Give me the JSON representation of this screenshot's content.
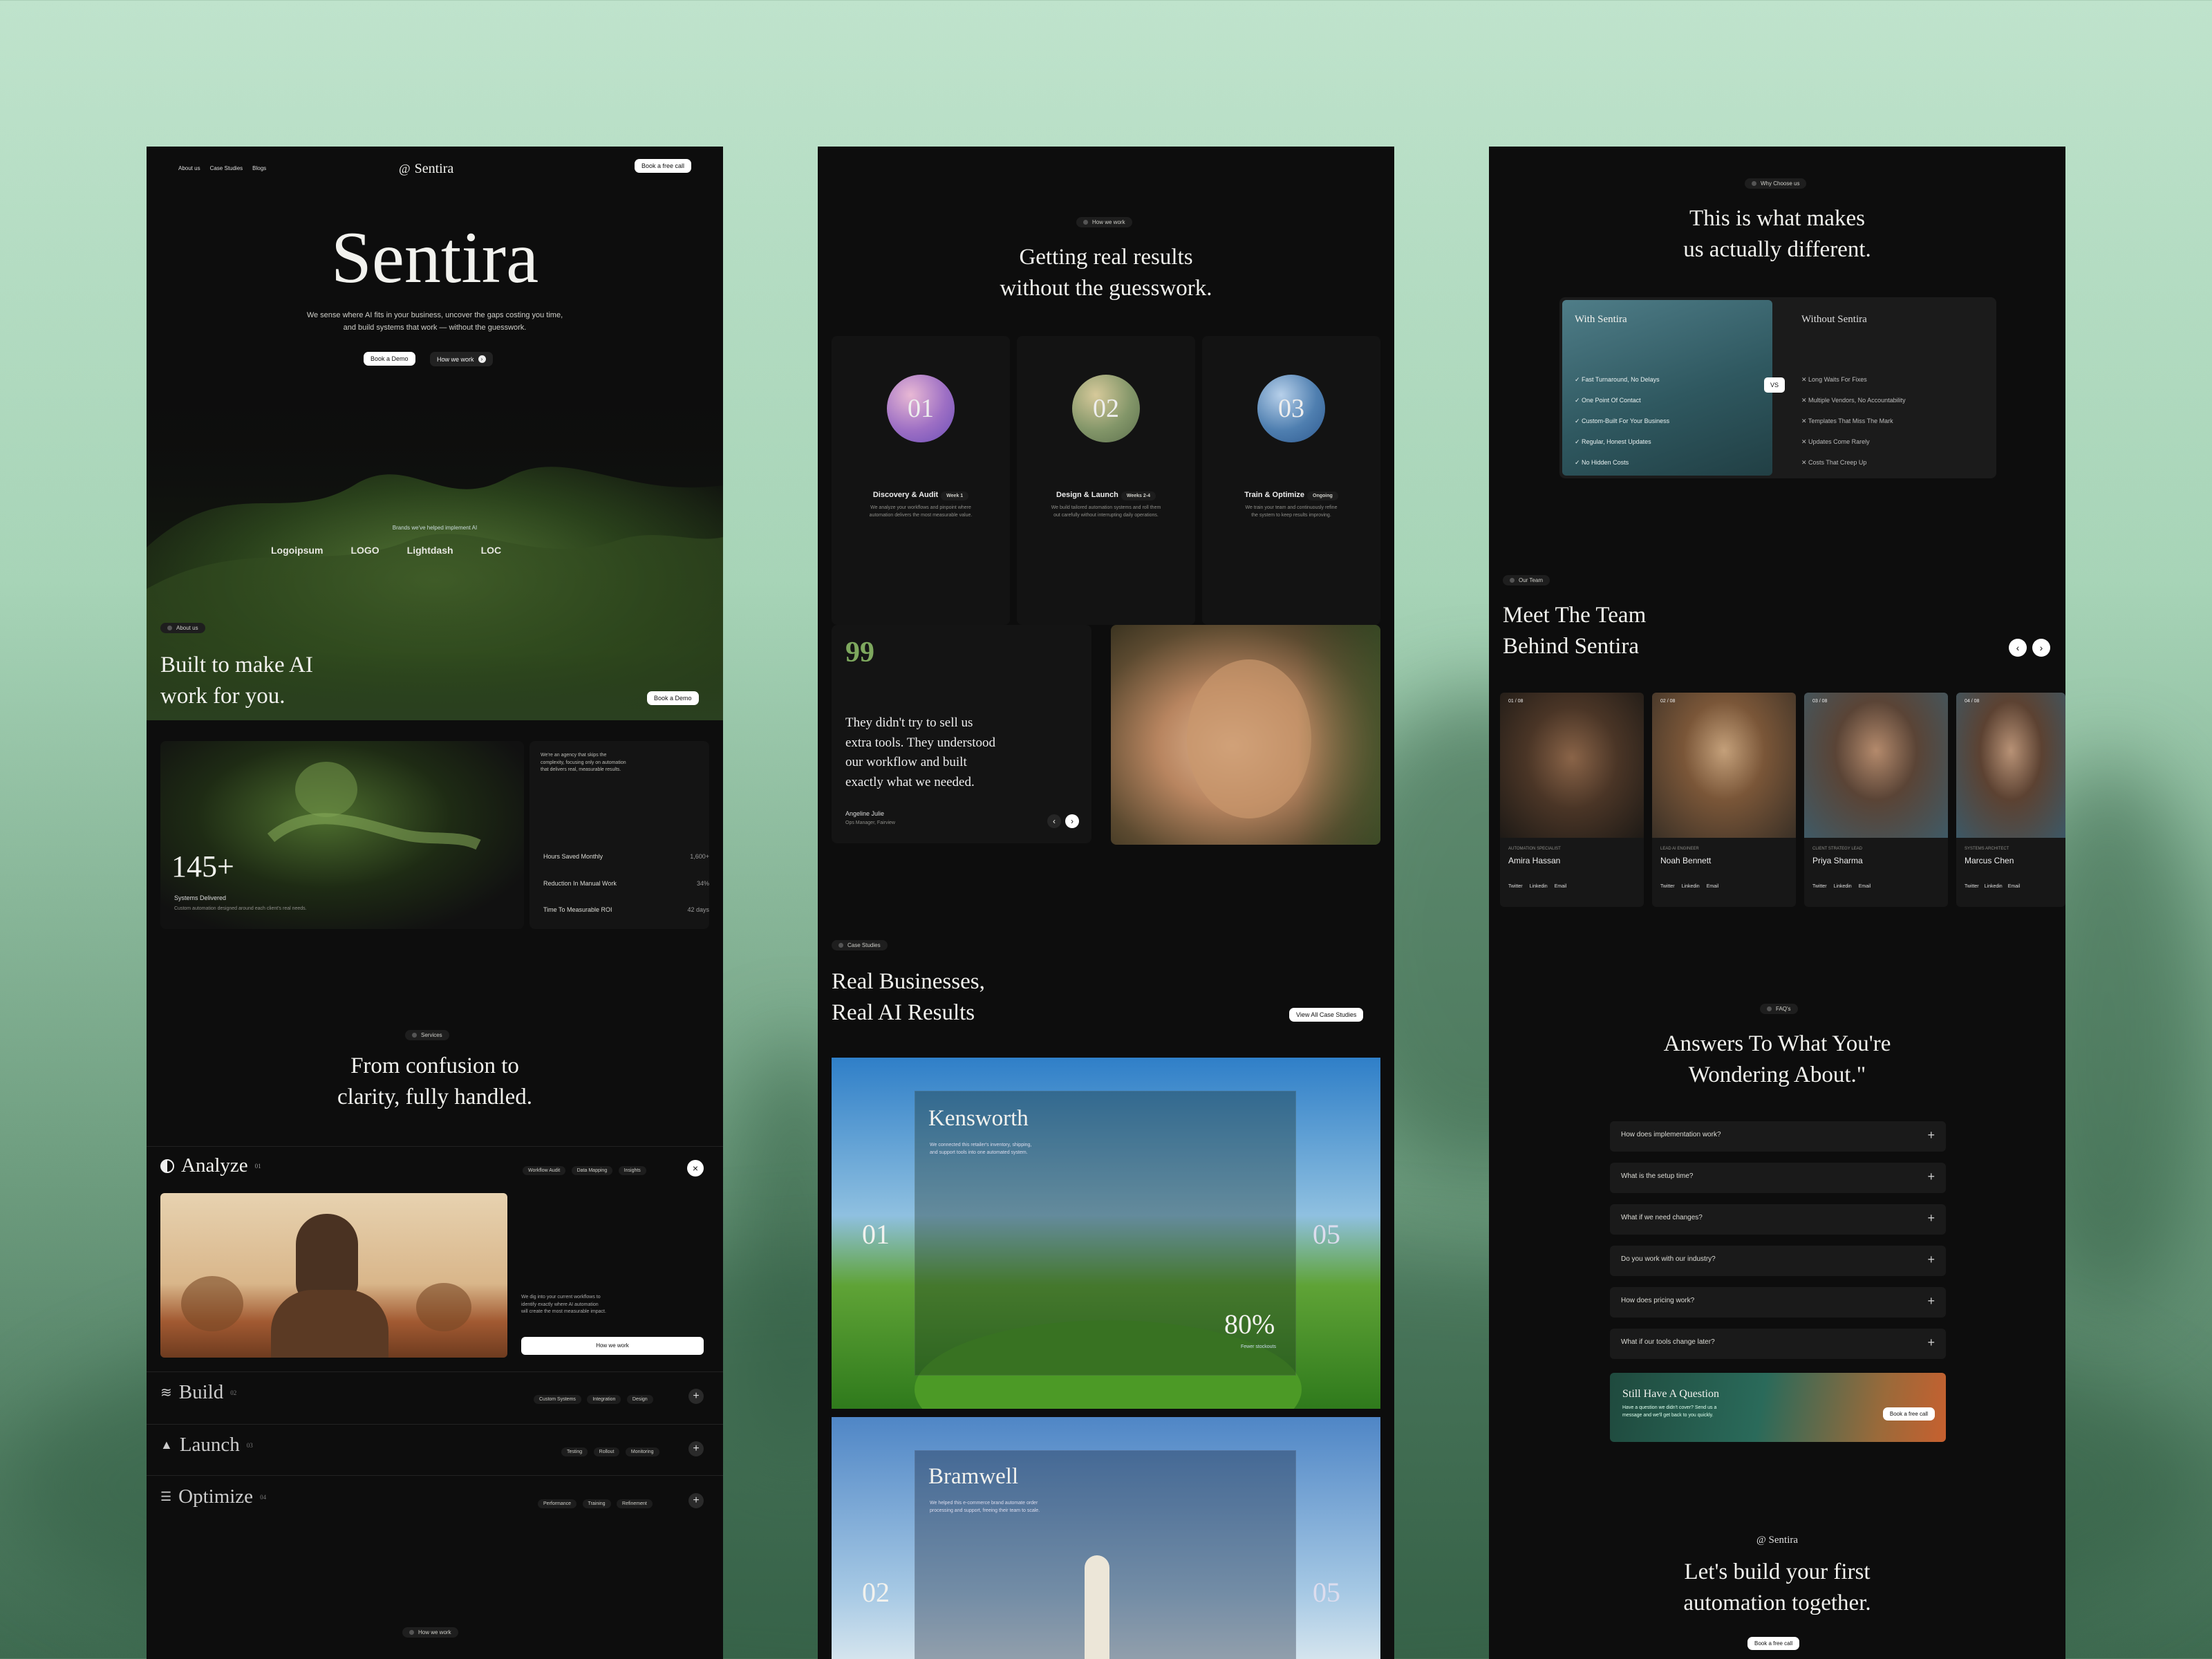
{
  "colors": {
    "accent_green": "#7ea85e",
    "bg_dark": "#0d0d0d",
    "card": "#161616",
    "frame_bg": "#b6ddc4"
  },
  "panel1": {
    "nav": {
      "about": "About us",
      "cases": "Case Studies",
      "blogs": "Blogs",
      "brand": "Sentira",
      "cta": "Book a free call"
    },
    "hero": {
      "title": "Sentira",
      "subtitle1": "We sense where AI fits in your business, uncover the gaps costing you time,",
      "subtitle2": "and build systems that work — without the guesswork.",
      "btn_demo": "Book a Demo",
      "btn_how": "How we work"
    },
    "brands": {
      "caption": "Brands we've helped implement AI",
      "items": [
        "Logoipsum",
        "LOGO",
        "Lightdash",
        "LOC"
      ]
    },
    "about": {
      "tag": "About us",
      "title1": "Built to make AI",
      "title2": "work for you.",
      "cta": "Book a Demo"
    },
    "stat": {
      "value": "145+",
      "label": "Systems Delivered",
      "desc": "Custom automation designed around each client's real needs."
    },
    "agency": {
      "desc1": "We're an agency that skips the",
      "desc2": "complexity, focusing only on automation",
      "desc3": "that delivers real, measurable results.",
      "rows": [
        {
          "label": "Hours Saved Monthly",
          "value": "1,600+"
        },
        {
          "label": "Reduction In Manual Work",
          "value": "34%"
        },
        {
          "label": "Time To Measurable ROI",
          "value": "42 days"
        }
      ]
    },
    "services": {
      "tag": "Services",
      "title1": "From confusion to",
      "title2": "clarity, fully handled.",
      "analyze": {
        "name": "Analyze",
        "num": "01",
        "chips": [
          "Workflow Audit",
          "Data Mapping",
          "Insights"
        ],
        "desc1": "We dig into your current workflows to",
        "desc2": "identify exactly where AI automation",
        "desc3": "will create the most measurable impact.",
        "btn": "How we work"
      },
      "items": [
        {
          "name": "Build",
          "num": "02",
          "chips": [
            "Custom Systems",
            "Integration",
            "Design"
          ]
        },
        {
          "name": "Launch",
          "num": "03",
          "chips": [
            "Testing",
            "Rollout",
            "Monitoring"
          ]
        },
        {
          "name": "Optimize",
          "num": "04",
          "chips": [
            "Performance",
            "Training",
            "Refinement"
          ]
        }
      ]
    },
    "bottom_tag": "How we work"
  },
  "panel2": {
    "how": {
      "tag": "How we work",
      "title1": "Getting real results",
      "title2": "without the guesswork.",
      "steps": [
        {
          "num": "01",
          "name": "Discovery & Audit",
          "badge": "Week 1",
          "d1": "We analyze your workflows and pinpoint where",
          "d2": "automation delivers the most measurable value."
        },
        {
          "num": "02",
          "name": "Design & Launch",
          "badge": "Weeks 2-4",
          "d1": "We build tailored automation systems and roll them",
          "d2": "out carefully without interrupting daily operations."
        },
        {
          "num": "03",
          "name": "Train & Optimize",
          "badge": "Ongoing",
          "d1": "We train your team and continuously refine",
          "d2": "the system to keep results improving."
        }
      ]
    },
    "quote": {
      "mark": "99",
      "l1": "They didn't try to sell us",
      "l2": "extra tools. They understood",
      "l3": "our workflow and built",
      "l4": "exactly what we needed.",
      "name": "Angeline Julie",
      "role": "Ops Manager, Fairview"
    },
    "cases": {
      "tag": "Case Studies",
      "title1": "Real Businesses,",
      "title2": "Real AI Results",
      "btn": "View All Case Studies",
      "items": [
        {
          "index": "01",
          "total": "05",
          "name": "Kensworth",
          "d1": "We connected this retailer's inventory, shipping,",
          "d2": "and support tools into one automated system.",
          "metric": "80%",
          "metric_label": "Fewer stockouts"
        },
        {
          "index": "02",
          "total": "05",
          "name": "Bramwell",
          "d1": "We helped this e-commerce brand automate order",
          "d2": "processing and support, freeing their team to scale."
        }
      ]
    }
  },
  "panel3": {
    "why": {
      "tag": "Why Choose us",
      "title1": "This is what makes",
      "title2": "us actually different.",
      "with": "With Sentira",
      "without": "Without Sentira",
      "vs": "VS",
      "with_items": [
        "Fast Turnaround, No Delays",
        "One Point Of Contact",
        "Custom-Built For Your Business",
        "Regular, Honest Updates",
        "No Hidden Costs"
      ],
      "without_items": [
        "Long Waits For Fixes",
        "Multiple Vendors, No Accountability",
        "Templates That Miss The Mark",
        "Updates Come Rarely",
        "Costs That Creep Up"
      ]
    },
    "team": {
      "tag": "Our Team",
      "title1": "Meet The Team",
      "title2": "Behind Sentira",
      "members": [
        {
          "idx": "01 / 08",
          "role": "AUTOMATION SPECIALIST",
          "name": "Amira Hassan"
        },
        {
          "idx": "02 / 08",
          "role": "LEAD AI ENGINEER",
          "name": "Noah Bennett"
        },
        {
          "idx": "03 / 08",
          "role": "CLIENT STRATEGY LEAD",
          "name": "Priya Sharma"
        },
        {
          "idx": "04 / 08",
          "role": "SYSTEMS ARCHITECT",
          "name": "Marcus Chen"
        }
      ],
      "links": [
        "Twitter",
        "Linkedin",
        "Email"
      ]
    },
    "faq": {
      "tag": "FAQ's",
      "title1": "Answers To What You're",
      "title2": "Wondering About.\"",
      "items": [
        "How does implementation work?",
        "What is the setup time?",
        "What if we need changes?",
        "Do you work with our industry?",
        "How does pricing work?",
        "What if our tools change later?"
      ]
    },
    "question": {
      "title": "Still Have A Question",
      "d1": "Have a question we didn't cover? Send us a",
      "d2": "message and we'll get back to you quickly.",
      "btn": "Book a free call"
    },
    "footer": {
      "brand": "Sentira",
      "title1": "Let's build your first",
      "title2": "automation together.",
      "btn": "Book a free call"
    }
  }
}
